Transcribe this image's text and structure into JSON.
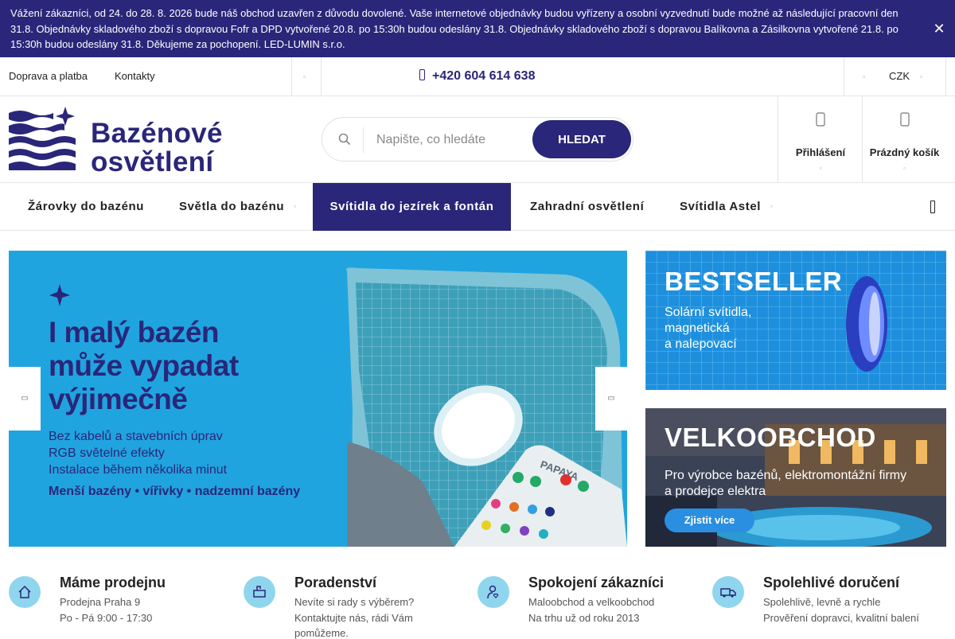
{
  "notice": {
    "text": "Vážení zákazníci, od 24. do 28. 8. 2026 bude náš obchod uzavřen z důvodu dovolené. Vaše internetové objednávky budou vyřízeny a osobní vyzvednutí bude možné až následující pracovní den 31.8. Objednávky skladového zboží s dopravou Fofr a DPD vytvořené 20.8. po 15:30h budou odeslány 31.8. Objednávky skladového zboží s dopravou Balíkovna a Zásilkovna vytvořené 21.8. po 15:30h budou odeslány 31.8. Děkujeme za pochopení. LED-LUMIN s.r.o.",
    "close_symbol": "✕"
  },
  "topbar": {
    "links": [
      "Doprava a platba",
      "Kontakty"
    ],
    "phone": "+420 604 614 638",
    "currency": "CZK"
  },
  "header": {
    "logo_line1": "Bazénové",
    "logo_line2": "osvětlení",
    "search_placeholder": "Napište, co hledáte",
    "search_button": "HLEDAT",
    "login_label": "Přihlášení",
    "cart_label": "Prázdný košík"
  },
  "nav": {
    "items": [
      {
        "label": "Žárovky do bazénu",
        "has_caret": false,
        "active": false
      },
      {
        "label": "Světla do bazénu",
        "has_caret": true,
        "active": false
      },
      {
        "label": "Svítidla do jezírek a fontán",
        "has_caret": false,
        "active": true
      },
      {
        "label": "Zahradní osvětlení",
        "has_caret": false,
        "active": false
      },
      {
        "label": "Svítidla Astel",
        "has_caret": true,
        "active": false
      }
    ]
  },
  "hero": {
    "title_lines": [
      "I malý bazén",
      "může vypadat",
      "výjimečně"
    ],
    "features": [
      "Bez kabelů a stavebních úprav",
      "RGB světelné efekty",
      "Instalace během několika minut"
    ],
    "types": "Menší bazény • vířivky • nadzemní bazény",
    "remote_brand": "PAPAYA"
  },
  "side_banners": [
    {
      "title": "BESTSELLER",
      "text_lines": [
        "Solární svítidla,",
        "magnetická",
        "a nalepovací"
      ]
    },
    {
      "title": "VELKOOBCHOD",
      "text_lines": [
        "Pro výrobce bazénů, elektromontážní firmy",
        "a prodejce elektra"
      ],
      "button": "Zjistit více"
    }
  ],
  "features": [
    {
      "title": "Máme prodejnu",
      "lines": [
        "Prodejna Praha 9",
        "Po - Pá 9:00 - 17:30"
      ],
      "icon": "home-icon"
    },
    {
      "title": "Poradenství",
      "lines": [
        "Nevíte si rady s výběrem?",
        "Kontaktujte nás, rádi Vám",
        "pomůžeme."
      ],
      "icon": "mailbox-icon"
    },
    {
      "title": "Spokojení zákazníci",
      "lines": [
        "Maloobchod a velkoobchod",
        "Na trhu už od roku 2013"
      ],
      "icon": "user-heart-icon"
    },
    {
      "title": "Spolehlivé doručení",
      "lines": [
        "Spolehlivě, levně a rychle",
        "Prověření dopravci, kvalitní balení"
      ],
      "icon": "truck-icon"
    }
  ],
  "colors": {
    "brand": "#2a2679",
    "hero_bg": "#20a4e0",
    "feature_icon_bg": "#8fd5ee"
  }
}
